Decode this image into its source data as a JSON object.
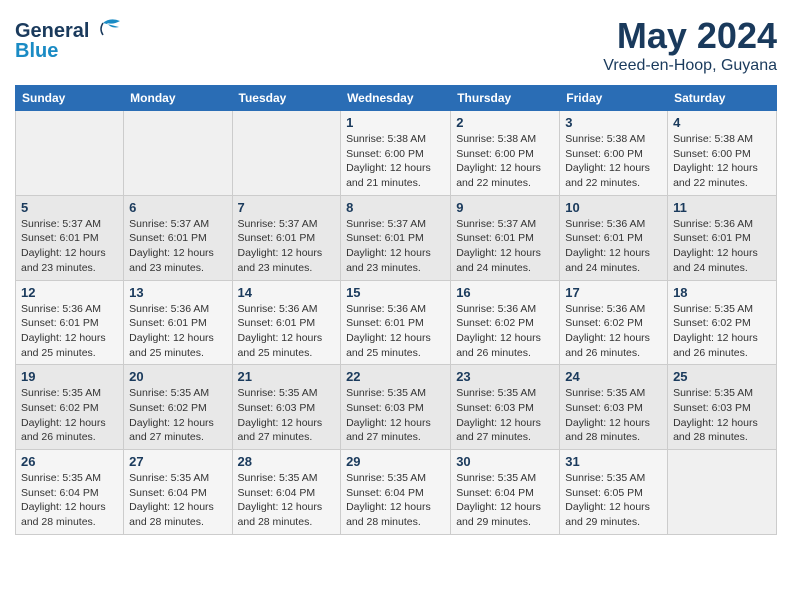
{
  "header": {
    "logo_line1": "General",
    "logo_line2": "Blue",
    "month": "May 2024",
    "location": "Vreed-en-Hoop, Guyana"
  },
  "weekdays": [
    "Sunday",
    "Monday",
    "Tuesday",
    "Wednesday",
    "Thursday",
    "Friday",
    "Saturday"
  ],
  "weeks": [
    [
      {
        "day": "",
        "info": ""
      },
      {
        "day": "",
        "info": ""
      },
      {
        "day": "",
        "info": ""
      },
      {
        "day": "1",
        "info": "Sunrise: 5:38 AM\nSunset: 6:00 PM\nDaylight: 12 hours\nand 21 minutes."
      },
      {
        "day": "2",
        "info": "Sunrise: 5:38 AM\nSunset: 6:00 PM\nDaylight: 12 hours\nand 22 minutes."
      },
      {
        "day": "3",
        "info": "Sunrise: 5:38 AM\nSunset: 6:00 PM\nDaylight: 12 hours\nand 22 minutes."
      },
      {
        "day": "4",
        "info": "Sunrise: 5:38 AM\nSunset: 6:00 PM\nDaylight: 12 hours\nand 22 minutes."
      }
    ],
    [
      {
        "day": "5",
        "info": "Sunrise: 5:37 AM\nSunset: 6:01 PM\nDaylight: 12 hours\nand 23 minutes."
      },
      {
        "day": "6",
        "info": "Sunrise: 5:37 AM\nSunset: 6:01 PM\nDaylight: 12 hours\nand 23 minutes."
      },
      {
        "day": "7",
        "info": "Sunrise: 5:37 AM\nSunset: 6:01 PM\nDaylight: 12 hours\nand 23 minutes."
      },
      {
        "day": "8",
        "info": "Sunrise: 5:37 AM\nSunset: 6:01 PM\nDaylight: 12 hours\nand 23 minutes."
      },
      {
        "day": "9",
        "info": "Sunrise: 5:37 AM\nSunset: 6:01 PM\nDaylight: 12 hours\nand 24 minutes."
      },
      {
        "day": "10",
        "info": "Sunrise: 5:36 AM\nSunset: 6:01 PM\nDaylight: 12 hours\nand 24 minutes."
      },
      {
        "day": "11",
        "info": "Sunrise: 5:36 AM\nSunset: 6:01 PM\nDaylight: 12 hours\nand 24 minutes."
      }
    ],
    [
      {
        "day": "12",
        "info": "Sunrise: 5:36 AM\nSunset: 6:01 PM\nDaylight: 12 hours\nand 25 minutes."
      },
      {
        "day": "13",
        "info": "Sunrise: 5:36 AM\nSunset: 6:01 PM\nDaylight: 12 hours\nand 25 minutes."
      },
      {
        "day": "14",
        "info": "Sunrise: 5:36 AM\nSunset: 6:01 PM\nDaylight: 12 hours\nand 25 minutes."
      },
      {
        "day": "15",
        "info": "Sunrise: 5:36 AM\nSunset: 6:01 PM\nDaylight: 12 hours\nand 25 minutes."
      },
      {
        "day": "16",
        "info": "Sunrise: 5:36 AM\nSunset: 6:02 PM\nDaylight: 12 hours\nand 26 minutes."
      },
      {
        "day": "17",
        "info": "Sunrise: 5:36 AM\nSunset: 6:02 PM\nDaylight: 12 hours\nand 26 minutes."
      },
      {
        "day": "18",
        "info": "Sunrise: 5:35 AM\nSunset: 6:02 PM\nDaylight: 12 hours\nand 26 minutes."
      }
    ],
    [
      {
        "day": "19",
        "info": "Sunrise: 5:35 AM\nSunset: 6:02 PM\nDaylight: 12 hours\nand 26 minutes."
      },
      {
        "day": "20",
        "info": "Sunrise: 5:35 AM\nSunset: 6:02 PM\nDaylight: 12 hours\nand 27 minutes."
      },
      {
        "day": "21",
        "info": "Sunrise: 5:35 AM\nSunset: 6:03 PM\nDaylight: 12 hours\nand 27 minutes."
      },
      {
        "day": "22",
        "info": "Sunrise: 5:35 AM\nSunset: 6:03 PM\nDaylight: 12 hours\nand 27 minutes."
      },
      {
        "day": "23",
        "info": "Sunrise: 5:35 AM\nSunset: 6:03 PM\nDaylight: 12 hours\nand 27 minutes."
      },
      {
        "day": "24",
        "info": "Sunrise: 5:35 AM\nSunset: 6:03 PM\nDaylight: 12 hours\nand 28 minutes."
      },
      {
        "day": "25",
        "info": "Sunrise: 5:35 AM\nSunset: 6:03 PM\nDaylight: 12 hours\nand 28 minutes."
      }
    ],
    [
      {
        "day": "26",
        "info": "Sunrise: 5:35 AM\nSunset: 6:04 PM\nDaylight: 12 hours\nand 28 minutes."
      },
      {
        "day": "27",
        "info": "Sunrise: 5:35 AM\nSunset: 6:04 PM\nDaylight: 12 hours\nand 28 minutes."
      },
      {
        "day": "28",
        "info": "Sunrise: 5:35 AM\nSunset: 6:04 PM\nDaylight: 12 hours\nand 28 minutes."
      },
      {
        "day": "29",
        "info": "Sunrise: 5:35 AM\nSunset: 6:04 PM\nDaylight: 12 hours\nand 28 minutes."
      },
      {
        "day": "30",
        "info": "Sunrise: 5:35 AM\nSunset: 6:04 PM\nDaylight: 12 hours\nand 29 minutes."
      },
      {
        "day": "31",
        "info": "Sunrise: 5:35 AM\nSunset: 6:05 PM\nDaylight: 12 hours\nand 29 minutes."
      },
      {
        "day": "",
        "info": ""
      }
    ]
  ]
}
